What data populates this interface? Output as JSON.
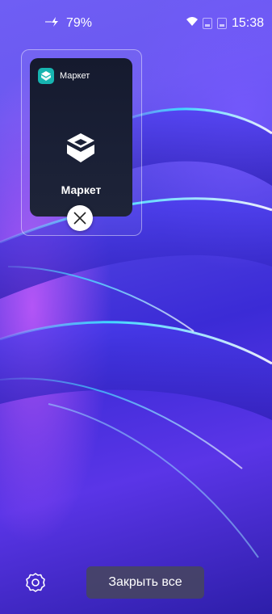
{
  "status_bar": {
    "battery": "79%",
    "time": "15:38",
    "icons": [
      "charging-icon",
      "wifi-icon",
      "sim1-icon",
      "sim2-icon"
    ]
  },
  "recent_apps": [
    {
      "name": "Маркет",
      "header_label": "Маркет",
      "accent_color": "#17b4b0"
    }
  ],
  "bottom_bar": {
    "settings_icon": "gear-icon",
    "close_all_label": "Закрыть все"
  },
  "colors": {
    "wallpaper_primary": "#4d3fe0",
    "wallpaper_accent": "#2fd3ff",
    "card_background": "#151a2e",
    "button_background": "#46465c"
  }
}
